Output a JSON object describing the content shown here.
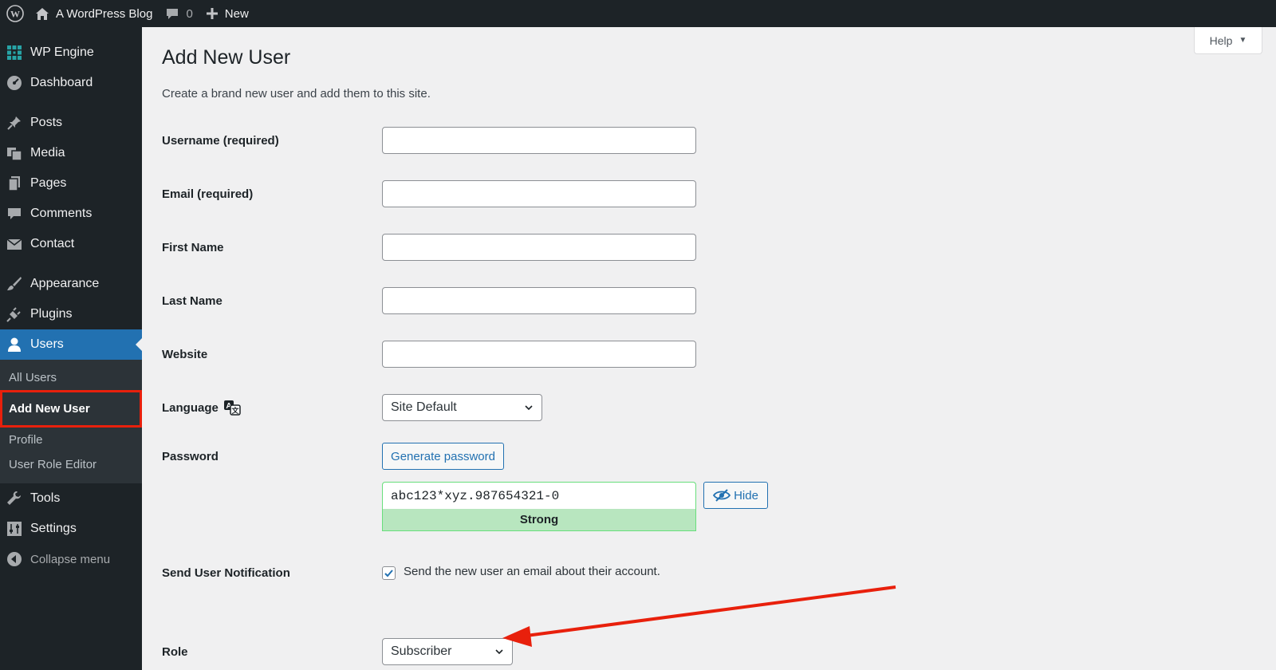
{
  "adminbar": {
    "site_name": "A WordPress Blog",
    "comments_count": "0",
    "new_label": "New"
  },
  "sidebar": {
    "items": [
      {
        "label": "WP Engine",
        "icon": "wpengine-grid-icon"
      },
      {
        "label": "Dashboard",
        "icon": "dashboard-gauge-icon"
      },
      {
        "label": "Posts",
        "icon": "pin-icon"
      },
      {
        "label": "Media",
        "icon": "media-icon"
      },
      {
        "label": "Pages",
        "icon": "pages-icon"
      },
      {
        "label": "Comments",
        "icon": "comment-bubble-icon"
      },
      {
        "label": "Contact",
        "icon": "envelope-icon"
      },
      {
        "label": "Appearance",
        "icon": "paintbrush-icon"
      },
      {
        "label": "Plugins",
        "icon": "plug-icon"
      },
      {
        "label": "Users",
        "icon": "user-icon"
      },
      {
        "label": "Tools",
        "icon": "wrench-icon"
      },
      {
        "label": "Settings",
        "icon": "sliders-icon"
      }
    ],
    "users_submenu": [
      "All Users",
      "Add New User",
      "Profile",
      "User Role Editor"
    ],
    "collapse_label": "Collapse menu"
  },
  "help_label": "Help",
  "page": {
    "title": "Add New User",
    "intro": "Create a brand new user and add them to this site."
  },
  "form": {
    "username_label": "Username (required)",
    "email_label": "Email (required)",
    "first_name_label": "First Name",
    "last_name_label": "Last Name",
    "website_label": "Website",
    "language_label": "Language",
    "language_value": "Site Default",
    "password_label": "Password",
    "generate_password_label": "Generate password",
    "password_value": "abc123*xyz.987654321-0",
    "hide_label": "Hide",
    "strength_label": "Strong",
    "notification_label": "Send User Notification",
    "notification_text": "Send the new user an email about their account.",
    "notification_checked": true,
    "role_label": "Role",
    "role_value": "Subscriber"
  },
  "colors": {
    "adminbar_bg": "#1d2327",
    "accent": "#2271b1",
    "annotation_red": "#e8200c",
    "strength_green": "#b8e6bf"
  }
}
